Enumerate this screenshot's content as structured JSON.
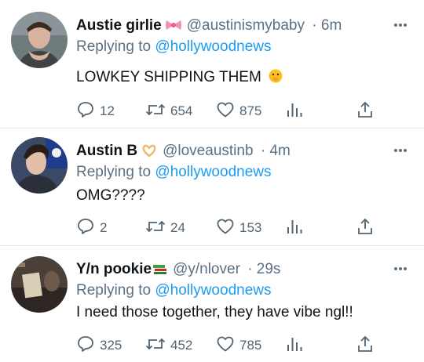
{
  "tweets": [
    {
      "name": "Austie girlie",
      "badge_icon": "bow-emoji",
      "handle": "@austinismybaby",
      "time": "· 6m",
      "reply_prefix": "Replying to",
      "reply_to": "@hollywoodnews",
      "text": "LOWKEY SHIPPING THEM",
      "text_emoji": "face-with-hand-over-mouth-emoji",
      "replies": "12",
      "retweets": "654",
      "likes": "875"
    },
    {
      "name": "Austin B",
      "badge_icon": "heart-hands-emoji",
      "handle": "@loveaustinb",
      "time": "· 4m",
      "reply_prefix": "Replying to",
      "reply_to": "@hollywoodnews",
      "text": "OMG????",
      "replies": "2",
      "retweets": "24",
      "likes": "153"
    },
    {
      "name": "Y/n pookie",
      "badge_icon": "books-emoji",
      "handle": "@y/nlover",
      "time": "· 29s",
      "reply_prefix": "Replying to",
      "reply_to": "@hollywoodnews",
      "text": "I need those together, they have vibe ngl!!",
      "replies": "325",
      "retweets": "452",
      "likes": "785"
    }
  ],
  "colors": {
    "text": "#0f1419",
    "secondary": "#5b7083",
    "link": "#1d9bf0",
    "divider": "#e6e9ec"
  }
}
